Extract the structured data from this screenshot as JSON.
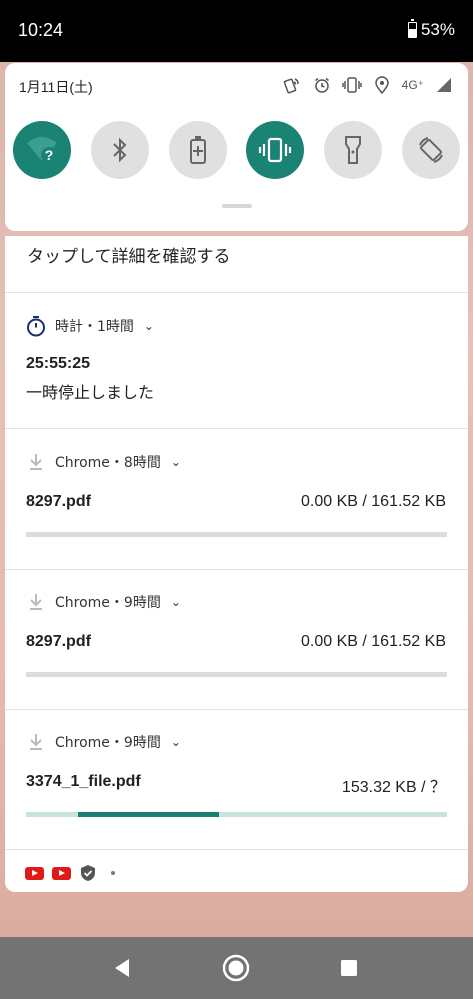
{
  "status_bar": {
    "time": "10:24",
    "battery": "53%"
  },
  "quick_settings": {
    "date": "1月11日(土)",
    "network": "4G⁺",
    "tiles": [
      {
        "name": "wifi",
        "state": "on"
      },
      {
        "name": "bluetooth",
        "state": "off"
      },
      {
        "name": "battery-saver",
        "state": "off"
      },
      {
        "name": "vibrate",
        "state": "on"
      },
      {
        "name": "flashlight",
        "state": "off"
      },
      {
        "name": "auto-rotate",
        "state": "off"
      }
    ]
  },
  "notifications": {
    "partial_text": "タップして詳細を確認する",
    "clock": {
      "header": "時計・1時間",
      "title": "25:55:25",
      "text": "一時停止しました"
    },
    "downloads": [
      {
        "header": "Chrome・8時間",
        "file": "8297.pdf",
        "size": "0.00 KB / 161.52 KB",
        "progress": 0
      },
      {
        "header": "Chrome・9時間",
        "file": "8297.pdf",
        "size": "0.00 KB / 161.52 KB",
        "progress": 0
      },
      {
        "header": "Chrome・9時間",
        "file": "3374_1_file.pdf",
        "size": "153.32 KB / ？",
        "progress": "indeterminate"
      }
    ]
  },
  "colors": {
    "accent": "#1a8374",
    "tile_off": "#e0e0e0",
    "youtube_red": "#e01a1a"
  }
}
